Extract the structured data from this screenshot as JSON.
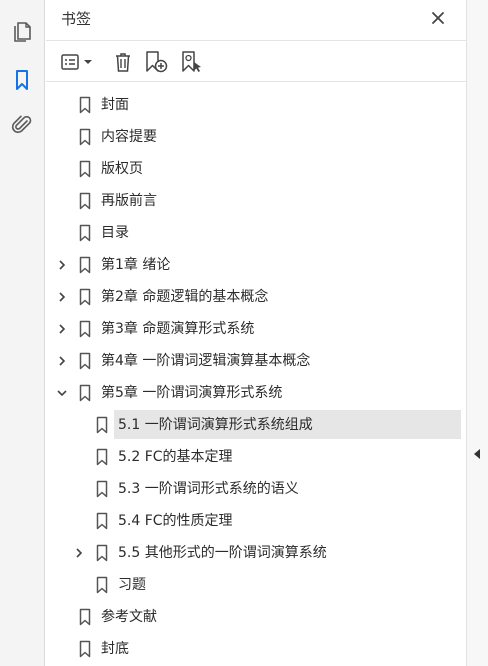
{
  "panel": {
    "title": "书签",
    "close_icon": "close-icon"
  },
  "rail": {
    "icons": [
      "pages-icon",
      "bookmark-icon",
      "attachment-icon"
    ],
    "active": "bookmark-icon",
    "accent": "#1473e6"
  },
  "toolbar": {
    "icons": [
      "options-menu-icon",
      "delete-icon",
      "new-bookmark-icon",
      "new-bookmark-from-selection-icon"
    ]
  },
  "bookmarks": [
    {
      "label": "封面",
      "level": 0,
      "expander": "none"
    },
    {
      "label": "内容提要",
      "level": 0,
      "expander": "none"
    },
    {
      "label": "版权页",
      "level": 0,
      "expander": "none"
    },
    {
      "label": "再版前言",
      "level": 0,
      "expander": "none"
    },
    {
      "label": "目录",
      "level": 0,
      "expander": "none"
    },
    {
      "label": "第1章 绪论",
      "level": 0,
      "expander": "collapsed"
    },
    {
      "label": "第2章 命题逻辑的基本概念",
      "level": 0,
      "expander": "collapsed"
    },
    {
      "label": "第3章 命题演算形式系统",
      "level": 0,
      "expander": "collapsed"
    },
    {
      "label": "第4章 一阶谓词逻辑演算基本概念",
      "level": 0,
      "expander": "collapsed"
    },
    {
      "label": "第5章 一阶谓词演算形式系统",
      "level": 0,
      "expander": "expanded"
    },
    {
      "label": "5.1 一阶谓词演算形式系统组成",
      "level": 1,
      "expander": "none",
      "selected": true
    },
    {
      "label": "5.2 FC的基本定理",
      "level": 1,
      "expander": "none"
    },
    {
      "label": "5.3 一阶谓词形式系统的语义",
      "level": 1,
      "expander": "none"
    },
    {
      "label": "5.4 FC的性质定理",
      "level": 1,
      "expander": "none"
    },
    {
      "label": "5.5 其他形式的一阶谓词演算系统",
      "level": 1,
      "expander": "collapsed"
    },
    {
      "label": "习题",
      "level": 1,
      "expander": "none"
    },
    {
      "label": "参考文献",
      "level": 0,
      "expander": "none"
    },
    {
      "label": "封底",
      "level": 0,
      "expander": "none"
    }
  ]
}
